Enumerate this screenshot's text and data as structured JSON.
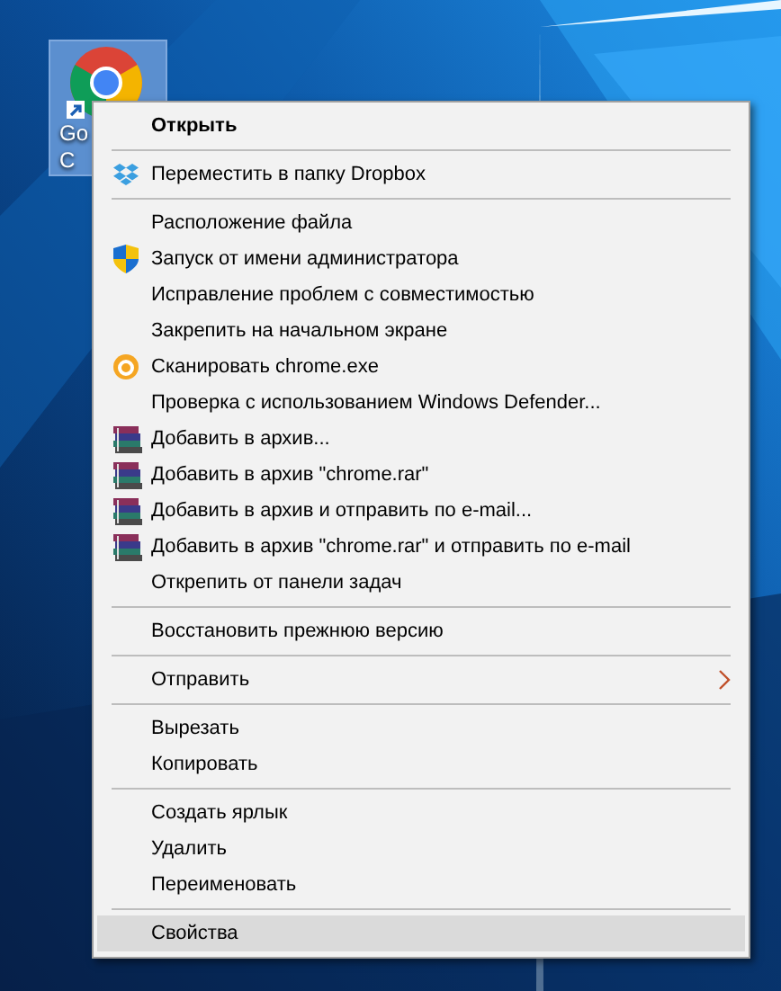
{
  "desktop_icon": {
    "label_lines": [
      "Go",
      "C"
    ],
    "selected": true
  },
  "context_menu": {
    "items": [
      {
        "kind": "plain",
        "label": "Открыть",
        "bold": true,
        "submenu": false,
        "selected": false
      },
      {
        "kind": "separator"
      },
      {
        "kind": "dropbox",
        "label": "Переместить в папку Dropbox",
        "bold": false,
        "submenu": false,
        "selected": false
      },
      {
        "kind": "separator"
      },
      {
        "kind": "plain",
        "label": "Расположение файла",
        "bold": false,
        "submenu": false,
        "selected": false
      },
      {
        "kind": "shield",
        "label": "Запуск от имени администратора",
        "bold": false,
        "submenu": false,
        "selected": false
      },
      {
        "kind": "plain",
        "label": "Исправление проблем с совместимостью",
        "bold": false,
        "submenu": false,
        "selected": false
      },
      {
        "kind": "plain",
        "label": "Закрепить на начальном экране",
        "bold": false,
        "submenu": false,
        "selected": false
      },
      {
        "kind": "scan",
        "label": "Сканировать chrome.exe",
        "bold": false,
        "submenu": false,
        "selected": false
      },
      {
        "kind": "plain",
        "label": "Проверка с использованием Windows Defender...",
        "bold": false,
        "submenu": false,
        "selected": false
      },
      {
        "kind": "archive",
        "label": "Добавить в архив...",
        "bold": false,
        "submenu": false,
        "selected": false
      },
      {
        "kind": "archive",
        "label": "Добавить в архив \"chrome.rar\"",
        "bold": false,
        "submenu": false,
        "selected": false
      },
      {
        "kind": "archive",
        "label": "Добавить в архив и отправить по e-mail...",
        "bold": false,
        "submenu": false,
        "selected": false
      },
      {
        "kind": "archive",
        "label": "Добавить в архив \"chrome.rar\" и отправить по e-mail",
        "bold": false,
        "submenu": false,
        "selected": false
      },
      {
        "kind": "plain",
        "label": "Открепить от панели задач",
        "bold": false,
        "submenu": false,
        "selected": false
      },
      {
        "kind": "separator"
      },
      {
        "kind": "plain",
        "label": "Восстановить прежнюю версию",
        "bold": false,
        "submenu": false,
        "selected": false
      },
      {
        "kind": "separator"
      },
      {
        "kind": "plain",
        "label": "Отправить",
        "bold": false,
        "submenu": true,
        "selected": false
      },
      {
        "kind": "separator"
      },
      {
        "kind": "plain",
        "label": "Вырезать",
        "bold": false,
        "submenu": false,
        "selected": false
      },
      {
        "kind": "plain",
        "label": "Копировать",
        "bold": false,
        "submenu": false,
        "selected": false
      },
      {
        "kind": "separator"
      },
      {
        "kind": "plain",
        "label": "Создать ярлык",
        "bold": false,
        "submenu": false,
        "selected": false
      },
      {
        "kind": "plain",
        "label": "Удалить",
        "bold": false,
        "submenu": false,
        "selected": false
      },
      {
        "kind": "plain",
        "label": "Переименовать",
        "bold": false,
        "submenu": false,
        "selected": false
      },
      {
        "kind": "separator"
      },
      {
        "kind": "plain",
        "label": "Свойства",
        "bold": false,
        "submenu": false,
        "selected": true
      }
    ]
  }
}
